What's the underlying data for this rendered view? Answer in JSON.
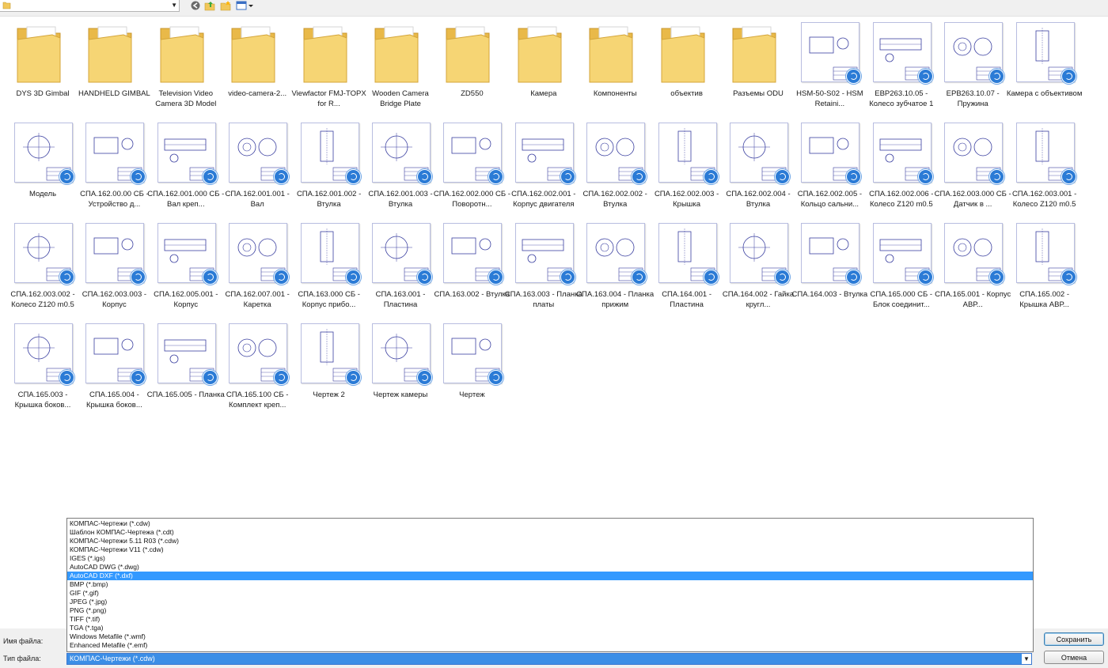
{
  "toolbar": {
    "path_value": "",
    "icons": [
      "folder-icon",
      "back-icon",
      "up-folder-icon",
      "new-folder-icon",
      "view-menu-icon"
    ]
  },
  "files": [
    {
      "label": "DYS 3D Gimbal",
      "kind": "folder"
    },
    {
      "label": "HANDHELD GIMBAL",
      "kind": "folder"
    },
    {
      "label": "Television Video Camera 3D Model",
      "kind": "folder"
    },
    {
      "label": "video-camera-2...",
      "kind": "folder"
    },
    {
      "label": "Viewfactor FMJ-TOPX for R...",
      "kind": "folder"
    },
    {
      "label": "Wooden Camera Bridge Plate",
      "kind": "folder"
    },
    {
      "label": "ZD550",
      "kind": "folder"
    },
    {
      "label": "Камера",
      "kind": "folder"
    },
    {
      "label": "Компоненты",
      "kind": "folder"
    },
    {
      "label": "объектив",
      "kind": "folder"
    },
    {
      "label": "Разъемы ODU",
      "kind": "folder"
    },
    {
      "label": "HSM-50-S02 - HSM Retaini...",
      "kind": "drawing"
    },
    {
      "label": "EBP263.10.05 - Колесо зубчатое 1",
      "kind": "drawing"
    },
    {
      "label": "EPB263.10.07 - Пружина",
      "kind": "drawing"
    },
    {
      "label": "Камера с объективом",
      "kind": "drawing"
    },
    {
      "label": "Модель",
      "kind": "drawing"
    },
    {
      "label": "СПА.162.00.00 СБ - Устройство д...",
      "kind": "drawing"
    },
    {
      "label": "СПА.162.001.000 СБ - Вал креп...",
      "kind": "drawing"
    },
    {
      "label": "СПА.162.001.001 - Вал",
      "kind": "drawing"
    },
    {
      "label": "СПА.162.001.002 - Втулка",
      "kind": "drawing"
    },
    {
      "label": "СПА.162.001.003 - Втулка",
      "kind": "drawing"
    },
    {
      "label": "СПА.162.002.000 СБ - Поворотн...",
      "kind": "drawing"
    },
    {
      "label": "СПА.162.002.001 - Корпус двигателя",
      "kind": "drawing"
    },
    {
      "label": "СПА.162.002.002 - Втулка",
      "kind": "drawing"
    },
    {
      "label": "СПА.162.002.003 - Крышка",
      "kind": "drawing"
    },
    {
      "label": "СПА.162.002.004 - Втулка",
      "kind": "drawing"
    },
    {
      "label": "СПА.162.002.005 - Кольцо сальни...",
      "kind": "drawing"
    },
    {
      "label": "СПА.162.002.006 - Колесо Z120 m0.5",
      "kind": "drawing"
    },
    {
      "label": "СПА.162.003.000 СБ - Датчик в ...",
      "kind": "drawing"
    },
    {
      "label": "СПА.162.003.001 - Колесо Z120 m0.5",
      "kind": "drawing"
    },
    {
      "label": "СПА.162.003.002 - Колесо Z120 m0.5",
      "kind": "drawing"
    },
    {
      "label": "СПА.162.003.003 - Корпус",
      "kind": "drawing"
    },
    {
      "label": "СПА.162.005.001 - Корпус",
      "kind": "drawing"
    },
    {
      "label": "СПА.162.007.001 - Каретка",
      "kind": "drawing"
    },
    {
      "label": "СПА.163.000 СБ - Корпус прибо...",
      "kind": "drawing"
    },
    {
      "label": "СПА.163.001 - Пластина",
      "kind": "drawing"
    },
    {
      "label": "СПА.163.002 - Втулка",
      "kind": "drawing"
    },
    {
      "label": "СПА.163.003 - Планка платы",
      "kind": "drawing"
    },
    {
      "label": "СПА.163.004 - Планка прижим",
      "kind": "drawing"
    },
    {
      "label": "СПА.164.001 - Пластина",
      "kind": "drawing"
    },
    {
      "label": "СПА.164.002 - Гайка кругл...",
      "kind": "drawing"
    },
    {
      "label": "СПА.164.003 - Втулка",
      "kind": "drawing"
    },
    {
      "label": "СПА.165.000 СБ - Блок соединит...",
      "kind": "drawing"
    },
    {
      "label": "СПА.165.001 - Корпус АВР...",
      "kind": "drawing"
    },
    {
      "label": "СПА.165.002 - Крышка АВР...",
      "kind": "drawing"
    },
    {
      "label": "СПА.165.003 - Крышка боков...",
      "kind": "drawing"
    },
    {
      "label": "СПА.165.004 - Крышка боков...",
      "kind": "drawing"
    },
    {
      "label": "СПА.165.005 - Планка",
      "kind": "drawing"
    },
    {
      "label": "СПА.165.100 СБ - Комплект креп...",
      "kind": "drawing"
    },
    {
      "label": "Чертеж 2",
      "kind": "drawing"
    },
    {
      "label": "Чертеж камеры",
      "kind": "drawing"
    },
    {
      "label": "Чертеж",
      "kind": "drawing"
    }
  ],
  "filetype_options": [
    "КОМПАС-Чертежи (*.cdw)",
    "Шаблон КОМПАС-Чертежа (*.cdt)",
    "КОМПАС-Чертежи 5.11 R03 (*.cdw)",
    "КОМПАС-Чертежи V11 (*.cdw)",
    "IGES (*.igs)",
    "AutoCAD DWG (*.dwg)",
    "AutoCAD DXF (*.dxf)",
    "BMP (*.bmp)",
    "GIF (*.gif)",
    "JPEG (*.jpg)",
    "PNG (*.png)",
    "TIFF (*.tif)",
    "TGA (*.tga)",
    "Windows Metafile (*.wmf)",
    "Enhanced Metafile (*.emf)"
  ],
  "selected_option": "AutoCAD DXF (*.dxf)",
  "form": {
    "filename_label": "Имя файла:",
    "filename_value": "",
    "filetype_label": "Тип файла:",
    "filetype_value": "КОМПАС-Чертежи (*.cdw)"
  },
  "buttons": {
    "save": "Сохранить",
    "cancel": "Отмена"
  },
  "colors": {
    "selection": "#3399ff",
    "folder": "#f3cf6a",
    "badge": "#2b7bd6",
    "drawing_lines": "#3a3fa0"
  }
}
